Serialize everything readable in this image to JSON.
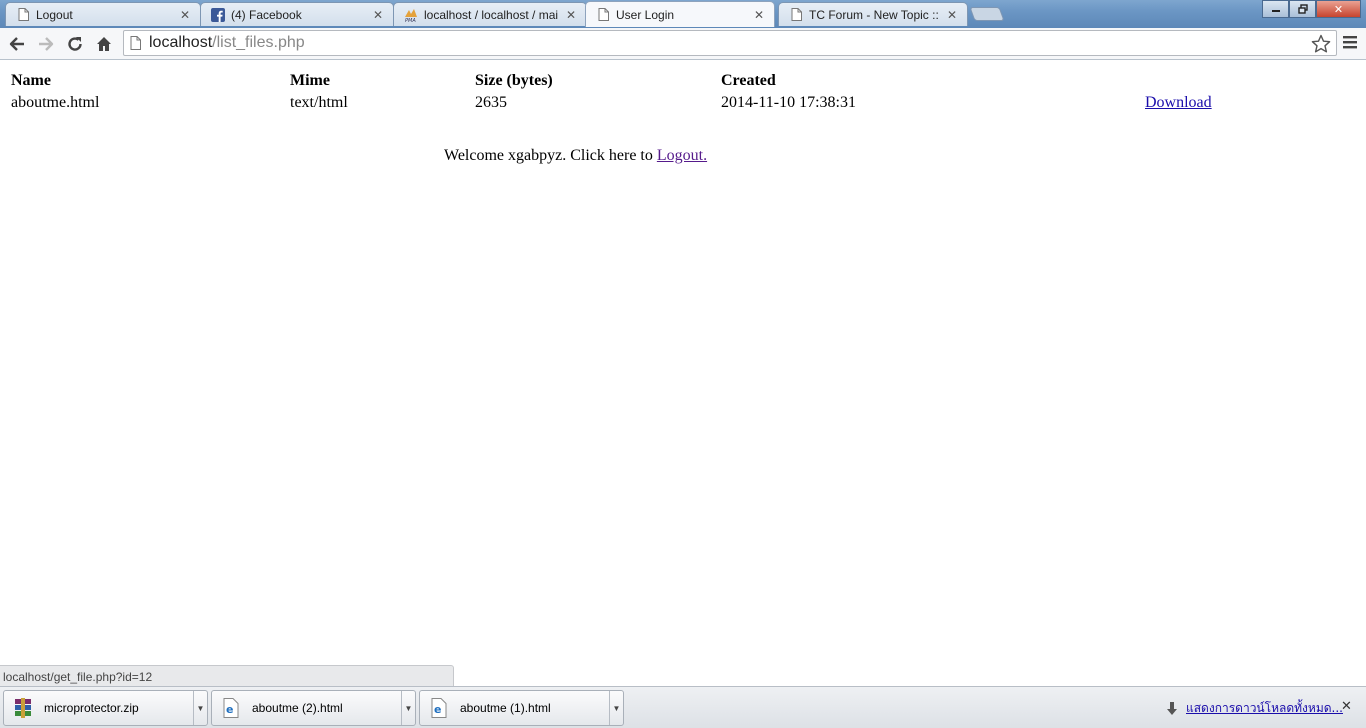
{
  "browser": {
    "tabs": [
      {
        "label": "Logout",
        "icon": "page-icon"
      },
      {
        "label": "(4) Facebook",
        "icon": "facebook-icon"
      },
      {
        "label": "localhost / localhost / mai",
        "icon": "phpmyadmin-icon"
      },
      {
        "label": "User Login",
        "icon": "page-icon",
        "active": true
      },
      {
        "label": "TC Forum - New Topic :: ",
        "icon": "page-icon"
      }
    ],
    "url_host": "localhost",
    "url_path": "/list_files.php"
  },
  "table": {
    "headers": [
      "Name",
      "Mime",
      "Size (bytes)",
      "Created"
    ],
    "rows": [
      {
        "name": "aboutme.html",
        "mime": "text/html",
        "size": "2635",
        "created": "2014-11-10 17:38:31",
        "action": "Download"
      }
    ]
  },
  "welcome": {
    "text": "Welcome xgabpyz. Click here to ",
    "link": "Logout."
  },
  "status_bar": "localhost/get_file.php?id=12",
  "downloads": {
    "items": [
      {
        "name": "microprotector.zip",
        "icon": "winrar-archive-icon"
      },
      {
        "name": "aboutme (2).html",
        "icon": "html-file-icon"
      },
      {
        "name": "aboutme (1).html",
        "icon": "html-file-icon"
      }
    ],
    "show_all": "แสดงการดาวน์โหลดทั้งหมด..."
  },
  "colors": {
    "link": "#1a0dab",
    "visited_link": "#551a8b",
    "title_bar": "#6b96c4",
    "facebook_blue": "#3b5998"
  }
}
